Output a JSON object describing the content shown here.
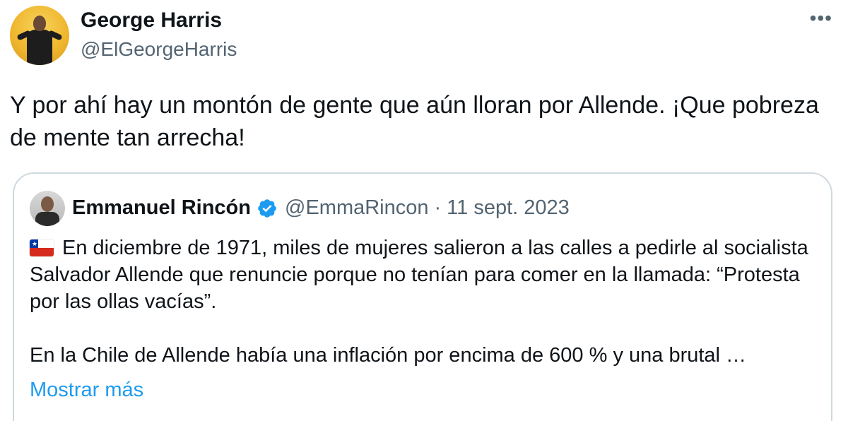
{
  "author": {
    "name": "George Harris",
    "handle": "@ElGeorgeHarris",
    "avatar_icon": "profile-avatar"
  },
  "menu_icon": "more-options-icon",
  "tweet_text": "Y por ahí hay un montón de gente que aún lloran por Allende. ¡Que pobreza de mente tan arrecha!",
  "quoted": {
    "name": "Emmanuel Rincón",
    "verified_icon": "verified-badge-icon",
    "handle": "@EmmaRincon",
    "separator": "·",
    "date": "11 sept. 2023",
    "flag_icon": "chile-flag-icon",
    "paragraph1": "En diciembre de 1971, miles de mujeres salieron a las calles a pedirle al socialista Salvador Allende que renuncie porque no tenían para comer en la llamada: “Protesta por las ollas vacías”.",
    "paragraph2": "En la Chile de Allende había una inflación por encima de 600 % y una brutal …",
    "show_more": "Mostrar más"
  },
  "colors": {
    "text": "#0f1419",
    "secondary": "#536471",
    "link": "#1d9bf0",
    "border": "#cfd9de",
    "verified": "#1d9bf0"
  }
}
